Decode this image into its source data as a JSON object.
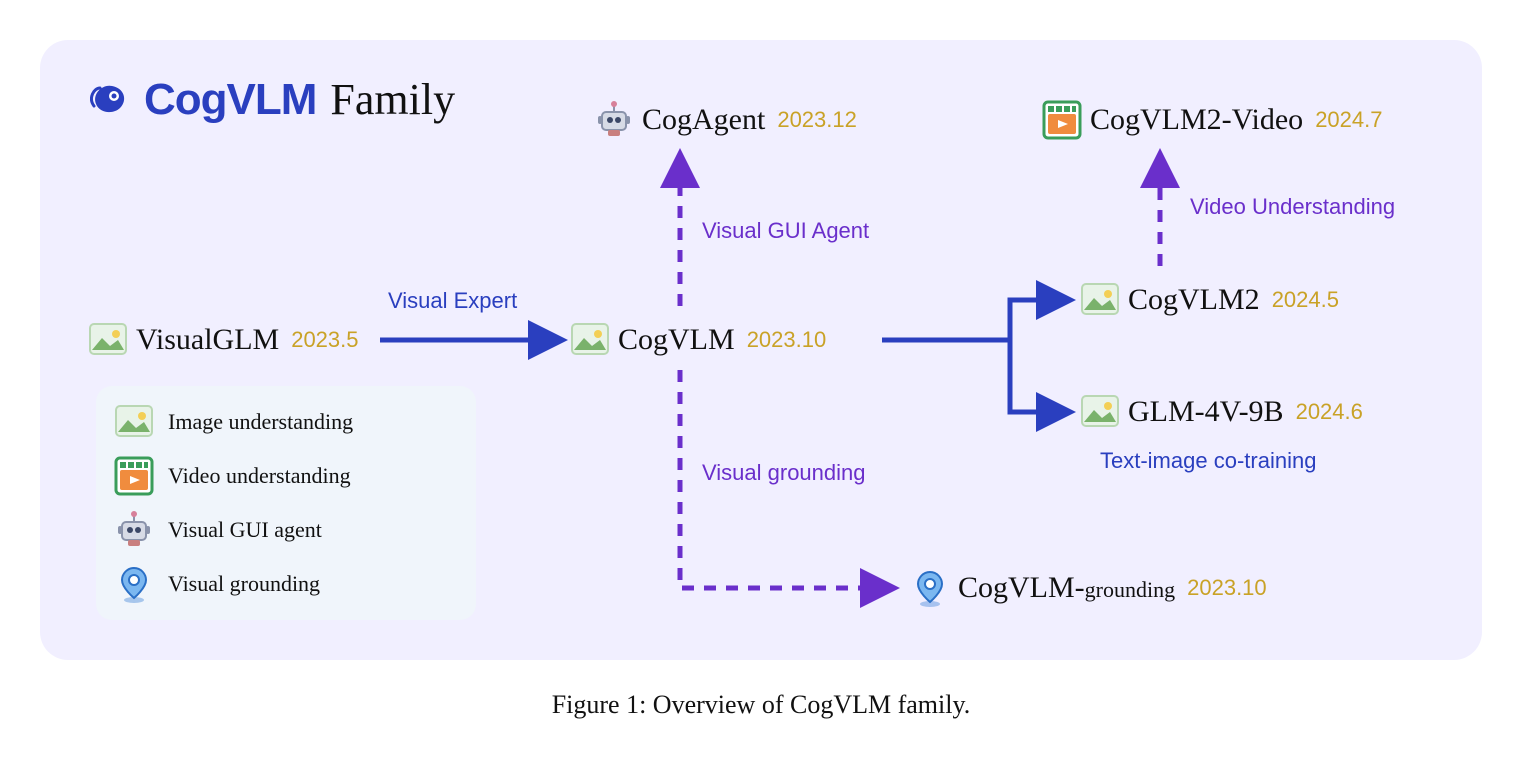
{
  "title": {
    "logo_text": "CogVLM",
    "suffix": "Family"
  },
  "nodes": {
    "visualglm": {
      "label": "VisualGLM",
      "date": "2023.5"
    },
    "cogvlm": {
      "label": "CogVLM",
      "date": "2023.10"
    },
    "cogagent": {
      "label": "CogAgent",
      "date": "2023.12"
    },
    "cogvlm2video": {
      "label": "CogVLM2-Video",
      "date": "2024.7"
    },
    "cogvlm2": {
      "label": "CogVLM2",
      "date": "2024.5"
    },
    "glm4v9b": {
      "label": "GLM-4V-9B",
      "date": "2024.6"
    },
    "cogvlm_grounding": {
      "label_main": "CogVLM-",
      "label_sub": "grounding",
      "date": "2023.10"
    }
  },
  "edges": {
    "visual_expert": "Visual Expert",
    "visual_gui_agent": "Visual GUI Agent",
    "visual_grounding": "Visual grounding",
    "video_understanding": "Video Understanding",
    "text_image_cotraining": "Text-image co-training"
  },
  "legend": {
    "image_understanding": "Image understanding",
    "video_understanding": "Video understanding",
    "visual_gui_agent": "Visual GUI agent",
    "visual_grounding": "Visual grounding"
  },
  "caption": "Figure 1: Overview of CogVLM family.",
  "colors": {
    "bg": "#f1efff",
    "blue": "#2a3fbf",
    "purple": "#6a2fcb",
    "gold": "#c9a227"
  }
}
